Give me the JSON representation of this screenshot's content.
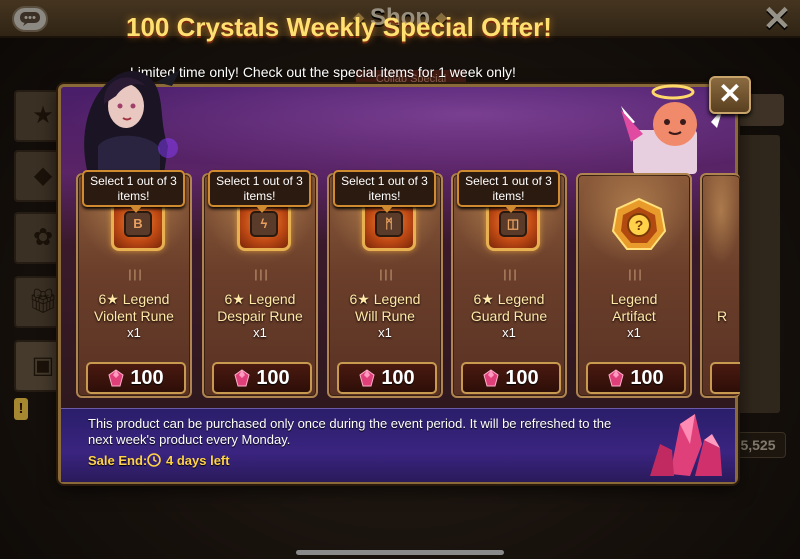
{
  "topbar": {
    "title": "Shop",
    "chat_icon": "chat-bubble-icon",
    "close_icon": "close-icon",
    "close_glyph": "✕"
  },
  "background": {
    "collab_tab": "Collab Special",
    "amount": "5,525"
  },
  "offer": {
    "title": "100 Crystals Weekly Special Offer!",
    "subtitle": "Limited time only! Check out the special items for 1 week only!",
    "close_glyph": "✕",
    "select_tag": "Select 1 out of 3 items!",
    "items": [
      {
        "name_line1": "6★ Legend",
        "name_line2": "Violent Rune",
        "qty": "x1",
        "price": "100",
        "rune_glyph": "B",
        "has_tag": true
      },
      {
        "name_line1": "6★ Legend",
        "name_line2": "Despair Rune",
        "qty": "x1",
        "price": "100",
        "rune_glyph": "ϟ",
        "has_tag": true
      },
      {
        "name_line1": "6★ Legend",
        "name_line2": "Will Rune",
        "qty": "x1",
        "price": "100",
        "rune_glyph": "ᛗ",
        "has_tag": true
      },
      {
        "name_line1": "6★ Legend",
        "name_line2": "Guard Rune",
        "qty": "x1",
        "price": "100",
        "rune_glyph": "◫",
        "has_tag": true
      },
      {
        "name_line1": "Legend",
        "name_line2": "Artifact",
        "qty": "x1",
        "price": "100",
        "rune_glyph": "?",
        "has_tag": false
      }
    ],
    "partial_item_name": "R",
    "footer_text": "This product can be purchased only once during the event period. It will be refreshed to the next week's product every Monday.",
    "sale_end_label": "Sale End:",
    "sale_end_value": "4 days left"
  },
  "colors": {
    "title": "#ffe070",
    "sale_end": "#ffd24a",
    "modal_border": "#8b6a3a",
    "footer_bg": "#3a2480"
  }
}
